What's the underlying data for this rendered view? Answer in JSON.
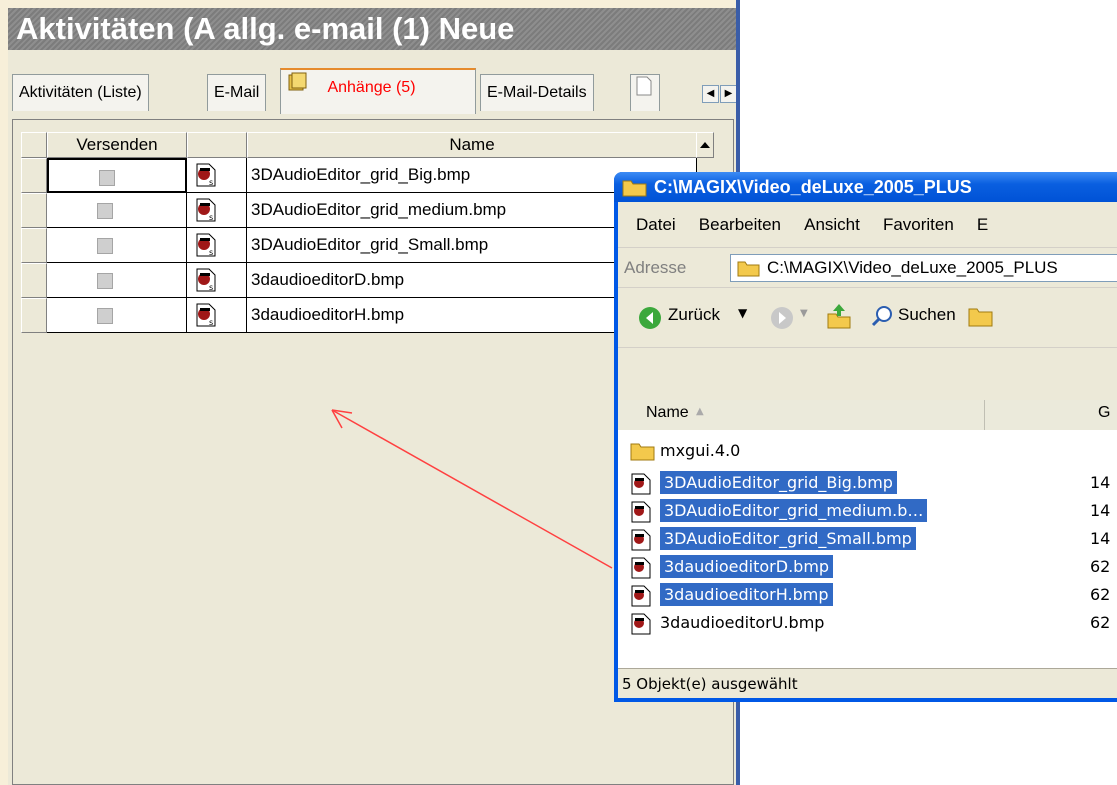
{
  "panel": {
    "title": "Aktivitäten (A allg. e-mail (1) Neue",
    "tabs": [
      {
        "label": "Aktivitäten (Liste)"
      },
      {
        "label": "E-Mail"
      },
      {
        "label": "Anhänge (5)"
      },
      {
        "label": "E-Mail-Details"
      }
    ],
    "grid": {
      "columns": [
        "Versenden",
        "",
        "Name"
      ],
      "rows": [
        {
          "name": "3DAudioEditor_grid_Big.bmp"
        },
        {
          "name": "3DAudioEditor_grid_medium.bmp"
        },
        {
          "name": "3DAudioEditor_grid_Small.bmp"
        },
        {
          "name": "3daudioeditorD.bmp"
        },
        {
          "name": "3daudioeditorH.bmp"
        }
      ]
    }
  },
  "explorer": {
    "title": "C:\\MAGIX\\Video_deLuxe_2005_PLUS",
    "menu": [
      "Datei",
      "Bearbeiten",
      "Ansicht",
      "Favoriten",
      "E"
    ],
    "address_label": "Adresse",
    "address_value": "C:\\MAGIX\\Video_deLuxe_2005_PLUS",
    "toolbar": {
      "back_label": "Zurück",
      "search_label": "Suchen"
    },
    "list_header": {
      "name": "Name",
      "size": "G"
    },
    "items": [
      {
        "name": "mxgui.4.0",
        "size": "",
        "selected": false,
        "type": "folder"
      },
      {
        "name": "3DAudioEditor_grid_Big.bmp",
        "size": "14",
        "selected": true,
        "type": "bmp"
      },
      {
        "name": "3DAudioEditor_grid_medium.b…",
        "size": "14",
        "selected": true,
        "type": "bmp"
      },
      {
        "name": "3DAudioEditor_grid_Small.bmp",
        "size": "14",
        "selected": true,
        "type": "bmp"
      },
      {
        "name": "3daudioeditorD.bmp",
        "size": "62",
        "selected": true,
        "type": "bmp"
      },
      {
        "name": "3daudioeditorH.bmp",
        "size": "62",
        "selected": true,
        "type": "bmp"
      },
      {
        "name": "3daudioeditorU.bmp",
        "size": "62",
        "selected": false,
        "type": "bmp"
      }
    ],
    "status": "5 Objekt(e) ausgewählt"
  },
  "colors": {
    "accent_red": "#ff0000",
    "selection_blue": "#316ac5",
    "xp_blue": "#0058e6"
  }
}
